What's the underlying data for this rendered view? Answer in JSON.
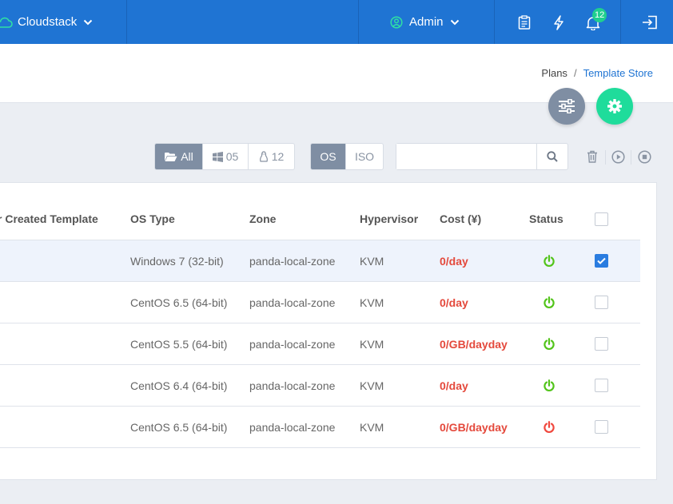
{
  "header": {
    "brand": "Cloudstack",
    "user": "Admin",
    "notification_count": "12"
  },
  "breadcrumb": {
    "parent": "Plans",
    "separator": "/",
    "current": "Template Store"
  },
  "toolbar": {
    "filters": [
      {
        "label": "All",
        "icon": "folder-open-icon",
        "active": true
      },
      {
        "label": "05",
        "icon": "windows-icon",
        "active": false
      },
      {
        "label": "12",
        "icon": "linux-icon",
        "active": false
      }
    ],
    "types": [
      {
        "label": "OS",
        "active": true
      },
      {
        "label": "ISO",
        "active": false
      }
    ],
    "search_value": "",
    "actions": [
      "trash-icon",
      "play-icon",
      "stop-icon"
    ]
  },
  "table": {
    "columns": [
      "r Created Template",
      "OS Type",
      "Zone",
      "Hypervisor",
      "Cost (¥)",
      "Status"
    ],
    "rows": [
      {
        "os": "Windows 7 (32-bit)",
        "zone": "panda-local-zone",
        "hypervisor": "KVM",
        "cost": "0/day",
        "status": "on",
        "checked": true
      },
      {
        "os": "CentOS 6.5 (64-bit)",
        "zone": "panda-local-zone",
        "hypervisor": "KVM",
        "cost": "0/day",
        "status": "on",
        "checked": false
      },
      {
        "os": "CentOS 5.5 (64-bit)",
        "zone": "panda-local-zone",
        "hypervisor": "KVM",
        "cost": "0/GB/dayday",
        "status": "on",
        "checked": false
      },
      {
        "os": "CentOS 6.4 (64-bit)",
        "zone": "panda-local-zone",
        "hypervisor": "KVM",
        "cost": "0/day",
        "status": "on",
        "checked": false
      },
      {
        "os": "CentOS 6.5 (64-bit)",
        "zone": "panda-local-zone",
        "hypervisor": "KVM",
        "cost": "0/GB/dayday",
        "status": "off",
        "checked": false
      }
    ]
  },
  "colors": {
    "topbar": "#1f74d3",
    "status_on": "#52c41a",
    "status_off": "#f0483e",
    "cost": "#e4493c",
    "fab_filter": "#7f8ea3",
    "fab_gear": "#1fdc9b"
  }
}
